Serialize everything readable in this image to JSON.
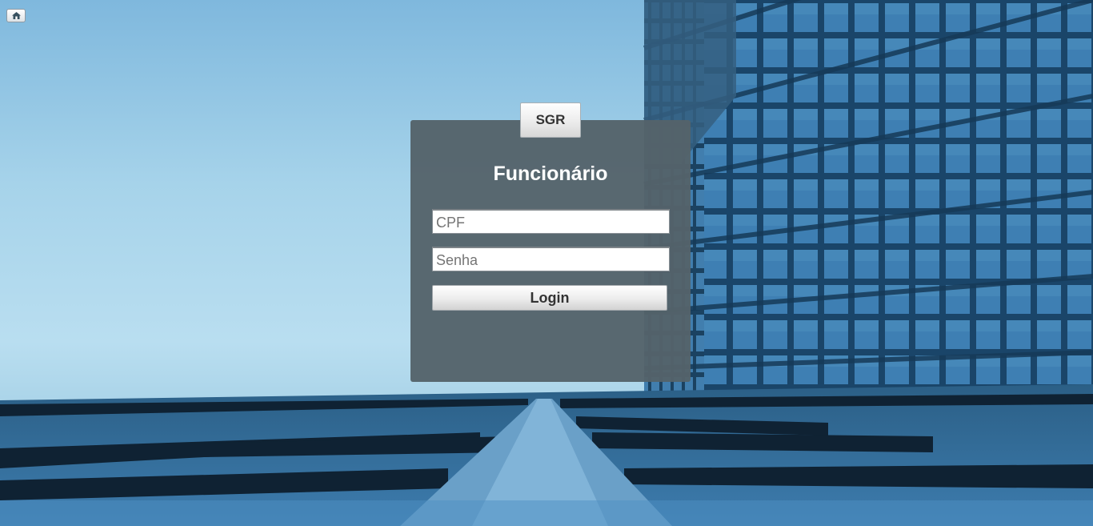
{
  "home_button": {
    "icon": "home-icon"
  },
  "login_panel": {
    "tab_label": "SGR",
    "title": "Funcionário",
    "cpf_field": {
      "placeholder": "CPF",
      "value": ""
    },
    "password_field": {
      "placeholder": "Senha",
      "value": ""
    },
    "login_button_label": "Login"
  },
  "colors": {
    "panel_background": "#54636a",
    "sky": "#a6d3ea",
    "title_text": "#ffffff"
  }
}
